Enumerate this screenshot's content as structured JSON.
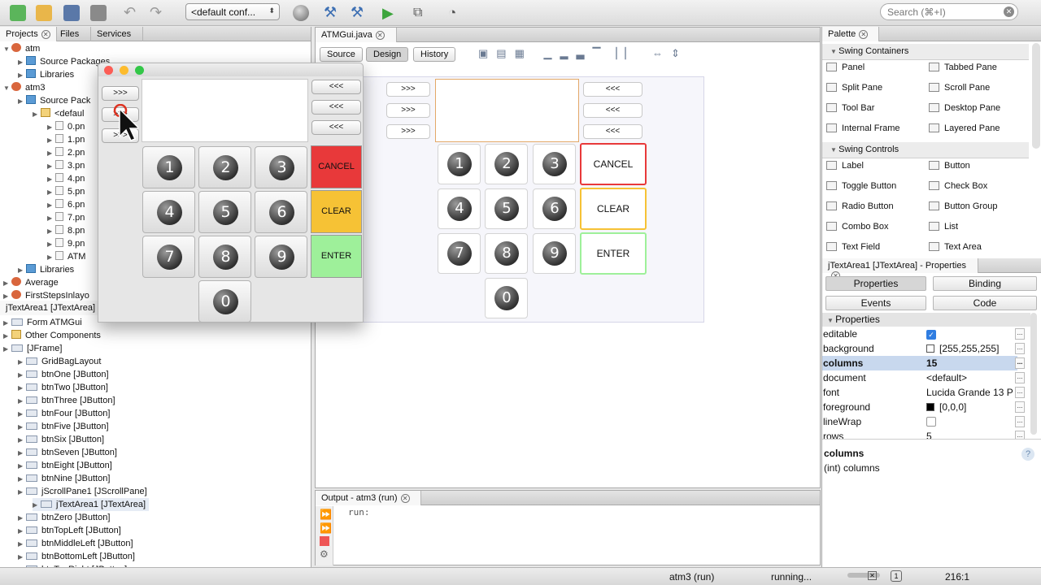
{
  "toolbar": {
    "config_label": "<default conf...",
    "search_placeholder": "Search (⌘+I)"
  },
  "projects_panel": {
    "tabs": [
      "Projects",
      "Files",
      "Services"
    ],
    "tree": [
      {
        "label": "atm",
        "icon": "project-icon",
        "level": 0,
        "expanded": true
      },
      {
        "label": "Source Packages",
        "icon": "package-folder-icon",
        "level": 1
      },
      {
        "label": "Libraries",
        "icon": "library-folder-icon",
        "level": 1
      },
      {
        "label": "atm3",
        "icon": "project-icon",
        "level": 0,
        "expanded": true
      },
      {
        "label": "Source Pack",
        "icon": "package-folder-icon",
        "level": 1
      },
      {
        "label": "<defaul",
        "icon": "package-icon",
        "level": 2
      },
      {
        "label": "0.pn",
        "icon": "file-icon",
        "level": 3
      },
      {
        "label": "1.pn",
        "icon": "file-icon",
        "level": 3
      },
      {
        "label": "2.pn",
        "icon": "file-icon",
        "level": 3
      },
      {
        "label": "3.pn",
        "icon": "file-icon",
        "level": 3
      },
      {
        "label": "4.pn",
        "icon": "file-icon",
        "level": 3
      },
      {
        "label": "5.pn",
        "icon": "file-icon",
        "level": 3
      },
      {
        "label": "6.pn",
        "icon": "file-icon",
        "level": 3
      },
      {
        "label": "7.pn",
        "icon": "file-icon",
        "level": 3
      },
      {
        "label": "8.pn",
        "icon": "file-icon",
        "level": 3
      },
      {
        "label": "9.pn",
        "icon": "file-icon",
        "level": 3
      },
      {
        "label": "ATM",
        "icon": "file-icon",
        "level": 3
      },
      {
        "label": "Libraries",
        "icon": "library-folder-icon",
        "level": 1
      },
      {
        "label": "Average",
        "icon": "project-icon",
        "level": 0
      },
      {
        "label": "FirstStepsInlayo",
        "icon": "project-icon",
        "level": 0
      }
    ]
  },
  "navigator": {
    "title": "jTextArea1 [JTextArea] - Navigator",
    "tree": [
      {
        "label": "Form ATMGui",
        "icon": "form-icon",
        "level": 0
      },
      {
        "label": "Other Components",
        "icon": "folder-icon",
        "level": 0
      },
      {
        "label": "[JFrame]",
        "icon": "frame-icon",
        "level": 0
      },
      {
        "label": "GridBagLayout",
        "icon": "layout-icon",
        "level": 1
      },
      {
        "label": "btnOne [JButton]",
        "icon": "button-icon",
        "level": 1
      },
      {
        "label": "btnTwo [JButton]",
        "icon": "button-icon",
        "level": 1
      },
      {
        "label": "btnThree [JButton]",
        "icon": "button-icon",
        "level": 1
      },
      {
        "label": "btnFour [JButton]",
        "icon": "button-icon",
        "level": 1
      },
      {
        "label": "btnFive [JButton]",
        "icon": "button-icon",
        "level": 1
      },
      {
        "label": "btnSix [JButton]",
        "icon": "button-icon",
        "level": 1
      },
      {
        "label": "btnSeven [JButton]",
        "icon": "button-icon",
        "level": 1
      },
      {
        "label": "btnEight [JButton]",
        "icon": "button-icon",
        "level": 1
      },
      {
        "label": "btnNine [JButton]",
        "icon": "button-icon",
        "level": 1
      },
      {
        "label": "jScrollPane1 [JScrollPane]",
        "icon": "scrollpane-icon",
        "level": 1
      },
      {
        "label": "jTextArea1 [JTextArea]",
        "icon": "textarea-icon",
        "level": 2,
        "selected": true
      },
      {
        "label": "btnZero [JButton]",
        "icon": "button-icon",
        "level": 1
      },
      {
        "label": "btnTopLeft [JButton]",
        "icon": "button-icon",
        "level": 1
      },
      {
        "label": "btnMiddleLeft [JButton]",
        "icon": "button-icon",
        "level": 1
      },
      {
        "label": "btnBottomLeft [JButton]",
        "icon": "button-icon",
        "level": 1
      },
      {
        "label": "btnTopRight [JButton]",
        "icon": "button-icon",
        "level": 1
      }
    ]
  },
  "running_frame": {
    "left_buttons": [
      ">>>",
      ">>>",
      ">>>"
    ],
    "right_buttons": [
      "<<<",
      "<<<",
      "<<<"
    ],
    "keys": [
      "1",
      "2",
      "3",
      "4",
      "5",
      "6",
      "7",
      "8",
      "9",
      "0"
    ],
    "cancel": "CANCEL",
    "clear": "CLEAR",
    "enter": "ENTER",
    "colors": {
      "cancel": "#e8393a",
      "clear": "#f6c235",
      "enter": "#9ef09a"
    }
  },
  "editor": {
    "file_tab": "ATMGui.java",
    "view_tabs": [
      "Source",
      "Design",
      "History"
    ],
    "design": {
      "left_buttons": [
        ">>>",
        ">>>",
        ">>>"
      ],
      "right_buttons": [
        "<<<",
        "<<<",
        "<<<"
      ],
      "keys": [
        "1",
        "2",
        "3",
        "4",
        "5",
        "6",
        "7",
        "8",
        "9",
        "0"
      ],
      "cancel": "CANCEL",
      "clear": "CLEAR",
      "enter": "ENTER"
    }
  },
  "palette": {
    "title": "Palette",
    "sections": [
      {
        "title": "Swing Containers",
        "items": [
          "Panel",
          "Tabbed Pane",
          "Split Pane",
          "Scroll Pane",
          "Tool Bar",
          "Desktop Pane",
          "Internal Frame",
          "Layered Pane"
        ]
      },
      {
        "title": "Swing Controls",
        "items": [
          "Label",
          "Button",
          "Toggle Button",
          "Check Box",
          "Radio Button",
          "Button Group",
          "Combo Box",
          "List",
          "Text Field",
          "Text Area"
        ]
      }
    ]
  },
  "properties": {
    "title": "jTextArea1 [JTextArea] - Properties",
    "tabs": [
      "Properties",
      "Binding",
      "Events",
      "Code"
    ],
    "section": "Properties",
    "rows": [
      {
        "name": "editable",
        "value": "",
        "checked": true
      },
      {
        "name": "background",
        "value": "[255,255,255]",
        "swatch": "#ffffff"
      },
      {
        "name": "columns",
        "value": "15",
        "selected": true
      },
      {
        "name": "document",
        "value": "<default>"
      },
      {
        "name": "font",
        "value": "Lucida Grande 13 P"
      },
      {
        "name": "foreground",
        "value": "[0,0,0]",
        "swatch": "#000000"
      },
      {
        "name": "lineWrap",
        "value": "",
        "checked": false
      },
      {
        "name": "rows",
        "value": "5"
      }
    ],
    "help_title": "columns",
    "help_text": "(int) columns"
  },
  "output": {
    "tab": "Output - atm3 (run)",
    "text": "run:"
  },
  "status": {
    "task": "atm3 (run)",
    "state": "running...",
    "position": "216:1"
  }
}
